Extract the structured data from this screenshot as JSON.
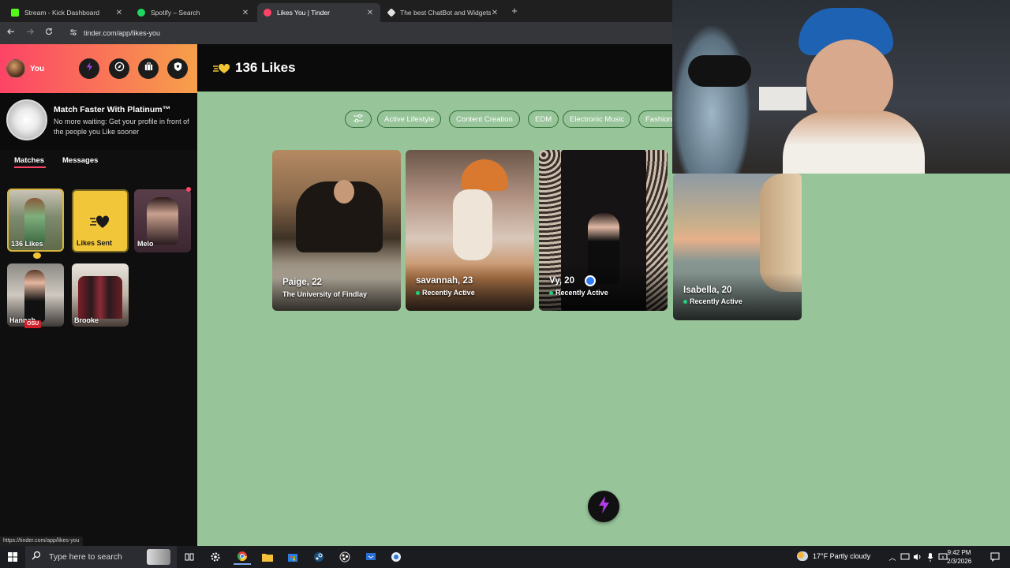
{
  "browser": {
    "tabs": [
      {
        "title": "Stream - Kick Dashboard",
        "favicon_color": "#53fc18"
      },
      {
        "title": "Spotify – Search",
        "favicon_color": "#1ed760"
      },
      {
        "title": "Likes You | Tinder",
        "favicon_color": "#fd4466"
      },
      {
        "title": "The best ChatBot and Widgets",
        "favicon_color": "#e0e0e0"
      }
    ],
    "url": "tinder.com/app/likes-you",
    "status_url": "https://tinder.com/app/likes-you"
  },
  "sidebar": {
    "user_label": "You",
    "header_icons": [
      "boost-icon",
      "explore-icon",
      "gold-home-icon",
      "safety-shield-icon"
    ],
    "promo": {
      "title": "Match Faster With Platinum™",
      "subtitle": "No more waiting: Get your profile in front of the people you Like sooner"
    },
    "tabs": [
      "Matches",
      "Messages"
    ],
    "match_cards": [
      {
        "label": "136 Likes"
      },
      {
        "label": "Likes Sent"
      },
      {
        "label": "Melo"
      },
      {
        "label": "Hannah",
        "badge": "OSU"
      },
      {
        "label": "Brooke"
      }
    ]
  },
  "main": {
    "title": "136 Likes",
    "filter_chips": [
      "Active Lifestyle",
      "Content Creation",
      "EDM",
      "Electronic Music",
      "Fashion"
    ],
    "profiles": [
      {
        "name": "Paige, 22",
        "subtitle": "The University of Findlay",
        "active": false
      },
      {
        "name": "savannah, 23",
        "subtitle": "Recently Active",
        "active": true
      },
      {
        "name": "Vy, 20",
        "subtitle": "Recently Active",
        "active": true,
        "verified": true
      },
      {
        "name": "Isabella, 20",
        "subtitle": "Recently Active",
        "active": true
      }
    ]
  },
  "taskbar": {
    "search_placeholder": "Type here to search",
    "weather": "17°F  Partly cloudy",
    "time": "9:42 PM",
    "date": "2/3/2026"
  },
  "colors": {
    "tinder_accent": "#fd4466",
    "background_green": "#98c49a",
    "active_dot": "#21d07a"
  }
}
